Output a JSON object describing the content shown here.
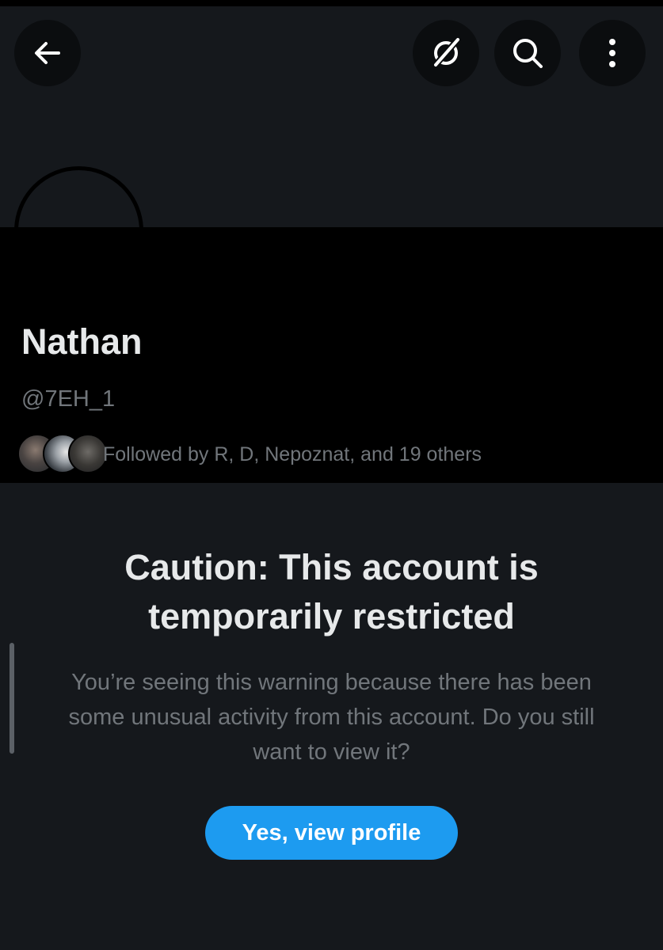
{
  "header": {
    "back_icon": "arrow-left-icon",
    "grok_icon": "grok-icon",
    "search_icon": "search-icon",
    "more_icon": "more-vertical-icon"
  },
  "profile": {
    "name": "Nathan",
    "handle": "@7EH_1",
    "followed_by_text": "Followed by R, D, Nepoznat, and 19 others"
  },
  "warning": {
    "title": "Caution: This account is temporarily restricted",
    "body": "You’re seeing this warning because there has been some unusual activity from this account. Do you still want to view it?",
    "button_label": "Yes, view profile"
  },
  "colors": {
    "background": "#15181c",
    "profile_background": "#000000",
    "accent": "#1d9bf0",
    "secondary_text": "#71767b",
    "primary_text": "#e7e9ea"
  }
}
